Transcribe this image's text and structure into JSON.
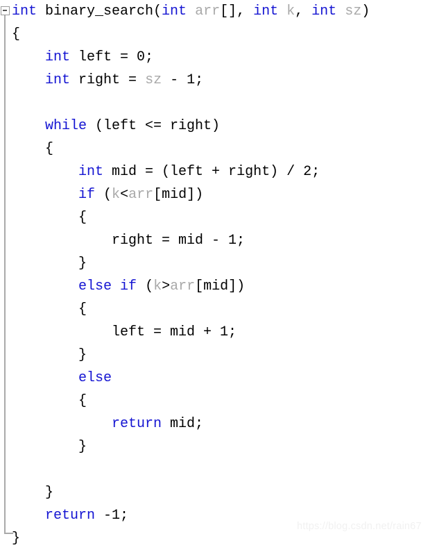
{
  "editor": {
    "language": "C",
    "background_color": "#ffffff",
    "keyword_color": "#1414d2",
    "identifier_color": "#a9a9a9",
    "plain_color": "#000000",
    "guide_color": "#a9a9a9",
    "fold_marker": "minus",
    "fold_marker_glyph": "−"
  },
  "watermark": {
    "text": "https://blog.csdn.net/rain67",
    "color": "#f1f1f1"
  },
  "code": {
    "function_name": "binary_search",
    "lines": [
      {
        "n": 1,
        "indent": 0,
        "tokens": [
          {
            "t": "int",
            "c": "kw"
          },
          {
            "t": " binary_search(",
            "c": "pl"
          },
          {
            "t": "int",
            "c": "kw"
          },
          {
            "t": " ",
            "c": "pl"
          },
          {
            "t": "arr",
            "c": "id"
          },
          {
            "t": "[], ",
            "c": "pl"
          },
          {
            "t": "int",
            "c": "kw"
          },
          {
            "t": " ",
            "c": "pl"
          },
          {
            "t": "k",
            "c": "id"
          },
          {
            "t": ", ",
            "c": "pl"
          },
          {
            "t": "int",
            "c": "kw"
          },
          {
            "t": " ",
            "c": "pl"
          },
          {
            "t": "sz",
            "c": "id"
          },
          {
            "t": ")",
            "c": "pl"
          }
        ]
      },
      {
        "n": 2,
        "indent": 0,
        "tokens": [
          {
            "t": "{",
            "c": "pl"
          }
        ]
      },
      {
        "n": 3,
        "indent": 1,
        "tokens": [
          {
            "t": "int",
            "c": "kw"
          },
          {
            "t": " left = 0;",
            "c": "pl"
          }
        ]
      },
      {
        "n": 4,
        "indent": 1,
        "tokens": [
          {
            "t": "int",
            "c": "kw"
          },
          {
            "t": " right = ",
            "c": "pl"
          },
          {
            "t": "sz",
            "c": "id"
          },
          {
            "t": " - 1;",
            "c": "pl"
          }
        ]
      },
      {
        "n": 5,
        "indent": 0,
        "tokens": [
          {
            "t": "",
            "c": "pl"
          }
        ]
      },
      {
        "n": 6,
        "indent": 1,
        "tokens": [
          {
            "t": "while",
            "c": "kw"
          },
          {
            "t": " (left <= right)",
            "c": "pl"
          }
        ]
      },
      {
        "n": 7,
        "indent": 1,
        "tokens": [
          {
            "t": "{",
            "c": "pl"
          }
        ]
      },
      {
        "n": 8,
        "indent": 2,
        "tokens": [
          {
            "t": "int",
            "c": "kw"
          },
          {
            "t": " mid = (left + right) / 2;",
            "c": "pl"
          }
        ]
      },
      {
        "n": 9,
        "indent": 2,
        "tokens": [
          {
            "t": "if",
            "c": "kw"
          },
          {
            "t": " (",
            "c": "pl"
          },
          {
            "t": "k",
            "c": "id"
          },
          {
            "t": "<",
            "c": "pl"
          },
          {
            "t": "arr",
            "c": "id"
          },
          {
            "t": "[mid])",
            "c": "pl"
          }
        ]
      },
      {
        "n": 10,
        "indent": 2,
        "tokens": [
          {
            "t": "{",
            "c": "pl"
          }
        ]
      },
      {
        "n": 11,
        "indent": 3,
        "tokens": [
          {
            "t": "right = mid - 1;",
            "c": "pl"
          }
        ]
      },
      {
        "n": 12,
        "indent": 2,
        "tokens": [
          {
            "t": "}",
            "c": "pl"
          }
        ]
      },
      {
        "n": 13,
        "indent": 2,
        "tokens": [
          {
            "t": "else",
            "c": "kw"
          },
          {
            "t": " ",
            "c": "pl"
          },
          {
            "t": "if",
            "c": "kw"
          },
          {
            "t": " (",
            "c": "pl"
          },
          {
            "t": "k",
            "c": "id"
          },
          {
            "t": ">",
            "c": "pl"
          },
          {
            "t": "arr",
            "c": "id"
          },
          {
            "t": "[mid])",
            "c": "pl"
          }
        ]
      },
      {
        "n": 14,
        "indent": 2,
        "tokens": [
          {
            "t": "{",
            "c": "pl"
          }
        ]
      },
      {
        "n": 15,
        "indent": 3,
        "tokens": [
          {
            "t": "left = mid + 1;",
            "c": "pl"
          }
        ]
      },
      {
        "n": 16,
        "indent": 2,
        "tokens": [
          {
            "t": "}",
            "c": "pl"
          }
        ]
      },
      {
        "n": 17,
        "indent": 2,
        "tokens": [
          {
            "t": "else",
            "c": "kw"
          }
        ]
      },
      {
        "n": 18,
        "indent": 2,
        "tokens": [
          {
            "t": "{",
            "c": "pl"
          }
        ]
      },
      {
        "n": 19,
        "indent": 3,
        "tokens": [
          {
            "t": "return",
            "c": "kw"
          },
          {
            "t": " mid;",
            "c": "pl"
          }
        ]
      },
      {
        "n": 20,
        "indent": 2,
        "tokens": [
          {
            "t": "}",
            "c": "pl"
          }
        ]
      },
      {
        "n": 21,
        "indent": 0,
        "tokens": [
          {
            "t": "",
            "c": "pl"
          }
        ]
      },
      {
        "n": 22,
        "indent": 1,
        "tokens": [
          {
            "t": "}",
            "c": "pl"
          }
        ]
      },
      {
        "n": 23,
        "indent": 1,
        "tokens": [
          {
            "t": "return",
            "c": "kw"
          },
          {
            "t": " -1;",
            "c": "pl"
          }
        ]
      },
      {
        "n": 24,
        "indent": 0,
        "tokens": [
          {
            "t": "}",
            "c": "pl"
          }
        ]
      }
    ]
  }
}
